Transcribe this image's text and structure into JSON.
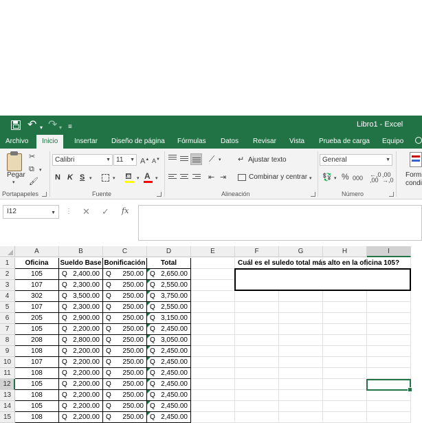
{
  "app": {
    "title": "Libro1 - Excel",
    "quick_access": {
      "save": "🖫",
      "undo": "↶",
      "redo": "↷",
      "more": "▾",
      "customize": "≡"
    }
  },
  "tabs": [
    "Archivo",
    "Inicio",
    "Insertar",
    "Diseño de página",
    "Fórmulas",
    "Datos",
    "Revisar",
    "Vista",
    "Prueba de carga",
    "Equipo"
  ],
  "ribbon": {
    "portapapeles": {
      "label": "Portapapeles",
      "paste": "Pegar"
    },
    "fuente": {
      "label": "Fuente",
      "font_name": "Calibri",
      "font_size": "11",
      "bold": "N",
      "italic": "K",
      "underline": "S",
      "grow": "A",
      "shrink": "A"
    },
    "alineacion": {
      "label": "Alineación",
      "wrap": "Ajustar texto",
      "merge": "Combinar y centrar"
    },
    "numero": {
      "label": "Número",
      "format": "General",
      "percent": "%",
      "thousands": "000",
      "inc_dec": "⁰⁰",
      "dec_dec": "⁰⁰"
    },
    "estilos": {
      "label": "Form condicio"
    }
  },
  "formula_bar": {
    "name_box": "I12",
    "fx": "fx",
    "cancel": "✕",
    "enter": "✓",
    "content": ""
  },
  "columns": [
    "A",
    "B",
    "C",
    "D",
    "E",
    "F",
    "G",
    "H",
    "I"
  ],
  "rows": [
    "1",
    "2",
    "3",
    "4",
    "5",
    "6",
    "7",
    "8",
    "9",
    "10",
    "11",
    "12",
    "13",
    "14",
    "15"
  ],
  "table": {
    "headers": [
      "Oficina",
      "Sueldo Base",
      "Bonificación",
      "Total"
    ],
    "currency": "Q",
    "data": [
      [
        "105",
        "2,400.00",
        "250.00",
        "2,650.00"
      ],
      [
        "107",
        "2,300.00",
        "250.00",
        "2,550.00"
      ],
      [
        "302",
        "3,500.00",
        "250.00",
        "3,750.00"
      ],
      [
        "107",
        "2,300.00",
        "250.00",
        "2,550.00"
      ],
      [
        "205",
        "2,900.00",
        "250.00",
        "3,150.00"
      ],
      [
        "105",
        "2,200.00",
        "250.00",
        "2,450.00"
      ],
      [
        "208",
        "2,800.00",
        "250.00",
        "3,050.00"
      ],
      [
        "108",
        "2,200.00",
        "250.00",
        "2,450.00"
      ],
      [
        "107",
        "2,200.00",
        "250.00",
        "2,450.00"
      ],
      [
        "108",
        "2,200.00",
        "250.00",
        "2,450.00"
      ],
      [
        "105",
        "2,200.00",
        "250.00",
        "2,450.00"
      ],
      [
        "108",
        "2,200.00",
        "250.00",
        "2,450.00"
      ],
      [
        "105",
        "2,200.00",
        "250.00",
        "2,450.00"
      ],
      [
        "108",
        "2,200.00",
        "250.00",
        "2,450.00"
      ]
    ]
  },
  "question": "Cuál es el suledo total más alto en la oficina 105?",
  "selected_cell": {
    "column": "I",
    "row": "12"
  },
  "colors": {
    "excel_green": "#217346",
    "ribbon_bg": "#f3f3f3"
  }
}
